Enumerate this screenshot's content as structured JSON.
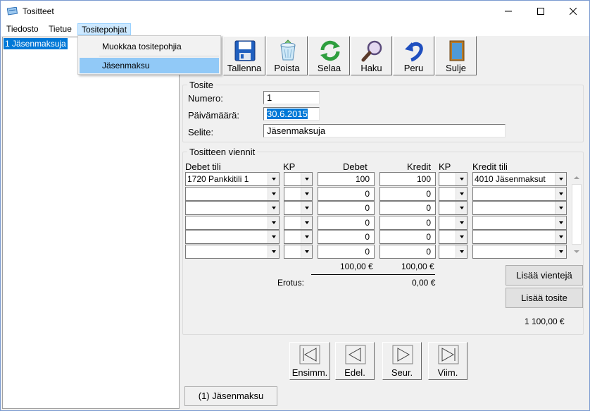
{
  "window": {
    "title": "Tositteet"
  },
  "menu": {
    "items": [
      "Tiedosto",
      "Tietue",
      "Tositepohjat"
    ]
  },
  "dropdown": {
    "items": [
      "Muokkaa tositepohjia",
      "Jäsenmaksu"
    ]
  },
  "sidebar": {
    "items": [
      "1 Jäsenmaksuja"
    ]
  },
  "toolbar": {
    "tallenna": "Tallenna",
    "poista": "Poista",
    "selaa": "Selaa",
    "haku": "Haku",
    "peru": "Peru",
    "sulje": "Sulje"
  },
  "tosite": {
    "legend": "Tosite",
    "numero_label": "Numero:",
    "numero_value": "1",
    "paivamaara_label": "Päivämäärä:",
    "paivamaara_value": "30.6.2015",
    "selite_label": "Selite:",
    "selite_value": "Jäsenmaksuja"
  },
  "viennit": {
    "legend": "Tositteen viennit",
    "headers": {
      "debet_tili": "Debet tili",
      "kp1": "KP",
      "debet": "Debet",
      "kredit": "Kredit",
      "kp2": "KP",
      "kredit_tili": "Kredit tili"
    },
    "rows": [
      {
        "debet_tili": "1720 Pankkitili 1",
        "debet": "100",
        "kredit": "100",
        "kredit_tili": "4010 Jäsenmaksut"
      },
      {
        "debet_tili": "",
        "debet": "0",
        "kredit": "0",
        "kredit_tili": ""
      },
      {
        "debet_tili": "",
        "debet": "0",
        "kredit": "0",
        "kredit_tili": ""
      },
      {
        "debet_tili": "",
        "debet": "0",
        "kredit": "0",
        "kredit_tili": ""
      },
      {
        "debet_tili": "",
        "debet": "0",
        "kredit": "0",
        "kredit_tili": ""
      },
      {
        "debet_tili": "",
        "debet": "0",
        "kredit": "0",
        "kredit_tili": ""
      }
    ],
    "debet_total": "100,00 €",
    "kredit_total": "100,00 €",
    "erotus_label": "Erotus:",
    "erotus_value": "0,00 €",
    "lisaa_vienteja": "Lisää vientejä",
    "lisaa_tosite": "Lisää tosite",
    "grand_total": "1 100,00 €"
  },
  "nav": {
    "ensimm": "Ensimm.",
    "edel": "Edel.",
    "seur": "Seur.",
    "viim": "Viim."
  },
  "bottom_button": "(1) Jäsenmaksu",
  "colors": {
    "selection": "#0078d7",
    "menu_highlight": "#91c9f7"
  }
}
